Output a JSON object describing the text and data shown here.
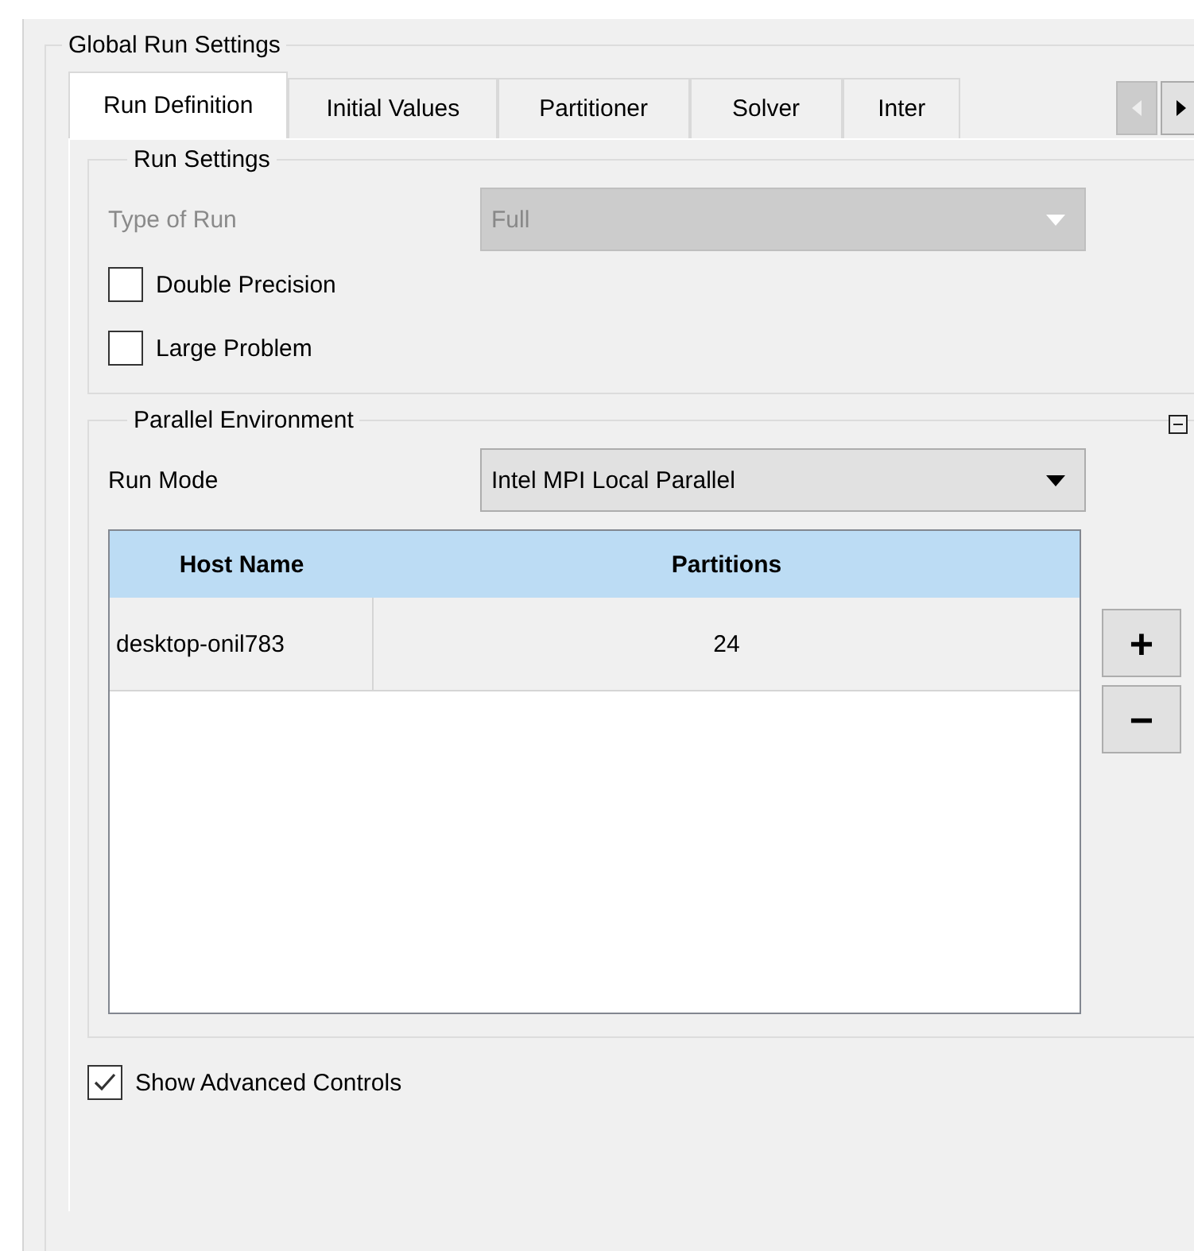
{
  "group_title": "Global Run Settings",
  "tabs": [
    {
      "label": "Run Definition",
      "selected": true
    },
    {
      "label": "Initial Values",
      "selected": false
    },
    {
      "label": "Partitioner",
      "selected": false
    },
    {
      "label": "Solver",
      "selected": false
    },
    {
      "label": "Inter",
      "selected": false
    }
  ],
  "run_settings": {
    "title": "Run Settings",
    "type_of_run": {
      "label": "Type of Run",
      "value": "Full",
      "disabled": true
    },
    "checkboxes": [
      {
        "label": "Double Precision",
        "checked": false
      },
      {
        "label": "Large Problem",
        "checked": false
      }
    ]
  },
  "parallel": {
    "title": "Parallel Environment",
    "expanded": true,
    "run_mode": {
      "label": "Run Mode",
      "value": "Intel MPI Local Parallel"
    },
    "columns": [
      "Host Name",
      "Partitions"
    ],
    "rows": [
      [
        "desktop-onil783",
        "24"
      ]
    ],
    "buttons": [
      "+",
      "−"
    ]
  },
  "show_advanced": {
    "label": "Show Advanced Controls",
    "checked": true
  }
}
